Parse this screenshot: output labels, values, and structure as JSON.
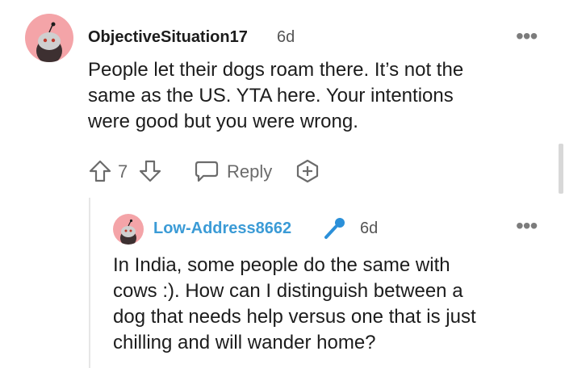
{
  "comment1": {
    "username": "ObjectiveSituation17",
    "time": "6d",
    "body_lines": [
      "People let their dogs roam there. It’s not the",
      "same as the US. YTA here. Your intentions",
      "were good but you were wrong."
    ],
    "vote_count": "7",
    "reply_label": "Reply",
    "more_label": "•••"
  },
  "comment2": {
    "username": "Low-Address8662",
    "time": "6d",
    "body_lines": [
      "In India, some people do the same with",
      "cows :). How can I distinguish between a",
      "dog that needs help versus one that is just",
      "chilling and will wander home?"
    ],
    "more_label": "•••"
  },
  "colors": {
    "avatar_bg": "#f4a4a8",
    "username2": "#3b9bd6",
    "mic_icon": "#2b90d9"
  }
}
